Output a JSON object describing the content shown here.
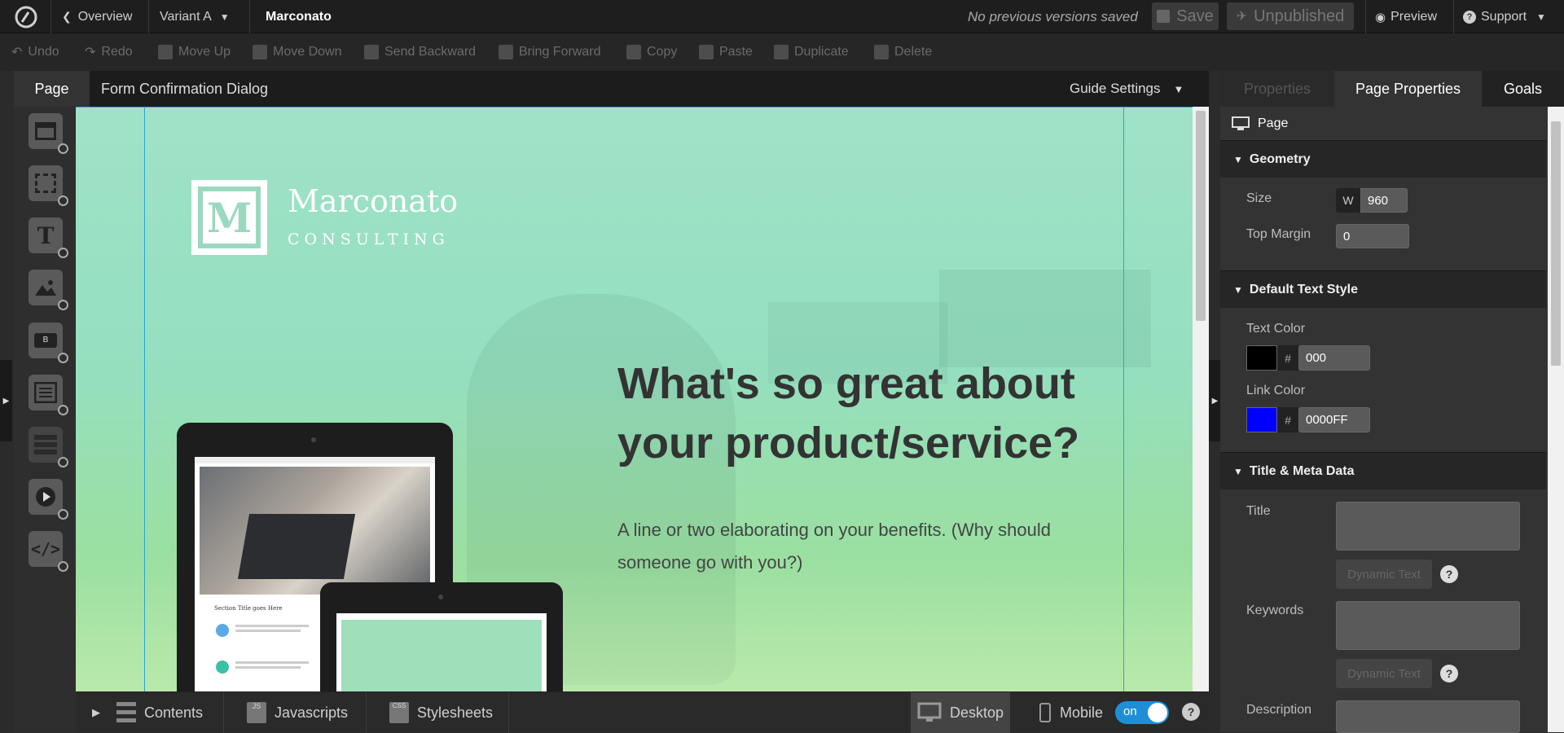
{
  "topbar": {
    "overview": "Overview",
    "variant": "Variant A",
    "page_name": "Marconato",
    "versions_status": "No previous versions saved",
    "save": "Save",
    "unpublished": "Unpublished",
    "preview": "Preview",
    "support": "Support"
  },
  "toolbar": {
    "undo": "Undo",
    "redo": "Redo",
    "move_up": "Move Up",
    "move_down": "Move Down",
    "send_backward": "Send Backward",
    "bring_forward": "Bring Forward",
    "copy": "Copy",
    "paste": "Paste",
    "duplicate": "Duplicate",
    "delete": "Delete"
  },
  "editor": {
    "tab_page": "Page",
    "tab_dialog": "Form Confirmation Dialog",
    "guide_settings": "Guide Settings"
  },
  "canvas": {
    "logo_letter": "M",
    "logo_name": "Marconato",
    "logo_sub": "CONSULTING",
    "headline": "What's so great about your product/service?",
    "subtext": "A line or two elaborating on your benefits. (Why should someone go with you?)",
    "tablet_section_title": "Section Title goes Here"
  },
  "bottombar": {
    "contents": "Contents",
    "js_badge": "JS",
    "javascripts": "Javascripts",
    "css_badge": "CSS",
    "stylesheets": "Stylesheets",
    "desktop": "Desktop",
    "mobile": "Mobile",
    "toggle": "on"
  },
  "panel": {
    "tabs": [
      "Properties",
      "Page Properties",
      "Goals"
    ],
    "page_label": "Page",
    "geometry": {
      "title": "Geometry",
      "size_label": "Size",
      "w_prefix": "W",
      "width_value": "960",
      "top_margin_label": "Top Margin",
      "top_margin_value": "0"
    },
    "text_style": {
      "title": "Default Text Style",
      "text_color_label": "Text Color",
      "text_color_value": "000",
      "link_color_label": "Link Color",
      "link_color_value": "0000FF",
      "hash": "#"
    },
    "meta": {
      "title": "Title & Meta Data",
      "title_label": "Title",
      "keywords_label": "Keywords",
      "description_label": "Description",
      "dynamic_text": "Dynamic Text",
      "help": "?"
    }
  },
  "colors": {
    "text_swatch": "#000000",
    "link_swatch": "#0000FF",
    "toggle_on": "#1e8fd6",
    "headline": "#333333"
  },
  "icons": [
    "logo-icon",
    "chevron-left-icon",
    "chevron-down-icon",
    "save-icon",
    "publish-icon",
    "eye-icon",
    "help-icon",
    "undo-icon",
    "redo-icon",
    "move-up-icon",
    "move-down-icon",
    "send-backward-icon",
    "bring-forward-icon",
    "copy-icon",
    "paste-icon",
    "duplicate-icon",
    "trash-icon",
    "section-icon",
    "box-icon",
    "text-icon",
    "image-icon",
    "button-icon",
    "form-icon",
    "list-icon",
    "video-icon",
    "code-icon",
    "desktop-icon",
    "mobile-icon",
    "monitor-icon"
  ]
}
